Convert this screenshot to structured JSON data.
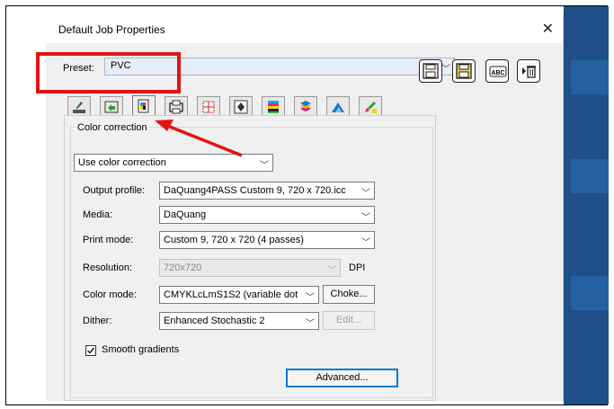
{
  "window": {
    "title": "Default Job Properties",
    "close_icon": "close-icon"
  },
  "preset": {
    "label": "Preset:",
    "value": "PVC"
  },
  "toolbar": {
    "icons": [
      "save-icon",
      "save-as-icon",
      "rename-abc-icon",
      "delete-trash-icon"
    ],
    "abc_text": "ABC"
  },
  "tabs": [
    "layout-tab",
    "transform-tab",
    "color-tab",
    "media-tab",
    "marks-tab",
    "position-tab",
    "inks-tab",
    "layers-tab",
    "finishing-tab",
    "effects-tab"
  ],
  "color_correction": {
    "group_label": "Color correction",
    "mode_value": "Use color correction",
    "output_profile": {
      "label": "Output profile:",
      "value": "DaQuang4PASS Custom 9, 720 x 720.icc"
    },
    "media": {
      "label": "Media:",
      "value": "DaQuang"
    },
    "print_mode": {
      "label": "Print mode:",
      "value": "Custom 9, 720 x 720 (4 passes)"
    },
    "resolution": {
      "label": "Resolution:",
      "value": "720x720",
      "unit": "DPI"
    },
    "color_mode": {
      "label": "Color mode:",
      "value": "CMYKLcLmS1S2 (variable dot",
      "button": "Choke..."
    },
    "dither": {
      "label": "Dither:",
      "value": "Enhanced Stochastic 2",
      "button": "Edit..."
    },
    "smooth_gradients": {
      "label": "Smooth gradients",
      "checked": true
    },
    "advanced_button": "Advanced..."
  },
  "colors": {
    "highlight": "#e31212",
    "accent": "#0078d7"
  }
}
